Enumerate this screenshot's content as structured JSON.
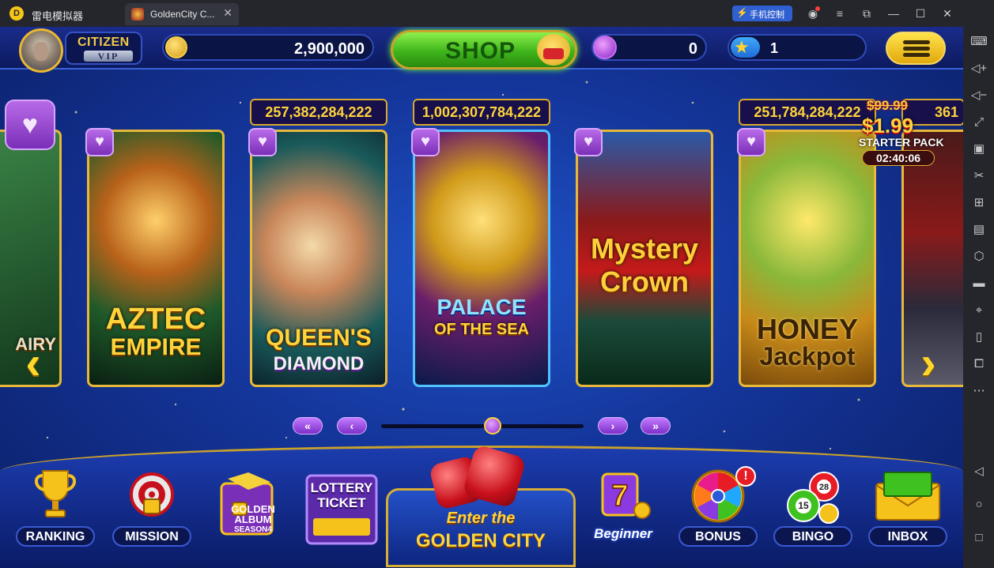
{
  "window": {
    "app_name": "雷电模拟器",
    "tab_title": "GoldenCity C...",
    "phone_control_label": "手机控制"
  },
  "player": {
    "rank": "CITIZEN",
    "tier": "VIP",
    "coins": "2,900,000",
    "gems": "0",
    "level": "1",
    "level_progress": 0.22
  },
  "shop": {
    "label": "SHOP"
  },
  "games": [
    {
      "name_line1": "AZTEC",
      "name_line2": "EMPIRE",
      "jackpot": null
    },
    {
      "name_line1": "QUEEN'S",
      "name_line2": "DIAMOND",
      "jackpot": "257,382,284,222"
    },
    {
      "name_line1": "PALACE",
      "name_line2": "OF THE SEA",
      "jackpot": "1,002,307,784,222"
    },
    {
      "name_line1": "Mystery",
      "name_line2": "Crown",
      "jackpot": null
    },
    {
      "name_line1": "HONEY",
      "name_line2": "Jackpot",
      "jackpot": "251,784,284,222"
    }
  ],
  "partial_cards": {
    "left_text": "AIRY",
    "right_jackpot": "361"
  },
  "starter_pack": {
    "old_price": "$99.99",
    "new_price": "$1.99",
    "label": "STARTER PACK",
    "timer": "02:40:06"
  },
  "pager": {
    "first": "«",
    "prev": "‹",
    "next": "›",
    "last": "»",
    "position": 0.55
  },
  "dock": {
    "items": [
      {
        "label": "RANKING",
        "icon": "trophy-icon"
      },
      {
        "label": "MISSION",
        "icon": "target-icon"
      },
      {
        "label": "GOLDEN ALBUM SEASON4",
        "icon": "album-icon"
      },
      {
        "label": "LOTTERY TICKET",
        "icon": "lottery-icon"
      },
      {
        "label": "Beginner",
        "icon": "slot-seven-icon"
      },
      {
        "label": "BONUS",
        "icon": "wheel-icon",
        "badge": "!"
      },
      {
        "label": "BINGO",
        "icon": "bingo-balls-icon"
      },
      {
        "label": "INBOX",
        "icon": "envelope-icon"
      }
    ],
    "center": {
      "line1": "Enter the",
      "line2": "GOLDEN CITY"
    },
    "album_text": {
      "line1": "GOLDEN",
      "line2": "ALBUM",
      "line3": "SEASON4"
    },
    "lottery_text": {
      "line1": "LOTTERY",
      "line2": "TICKET"
    },
    "bingo_numbers": [
      "15",
      "28"
    ]
  },
  "colors": {
    "gold": "#ffd43a",
    "game_bg": "#14359a",
    "shop_green": "#3fb51b",
    "fav_purple": "#7a2fb8"
  }
}
